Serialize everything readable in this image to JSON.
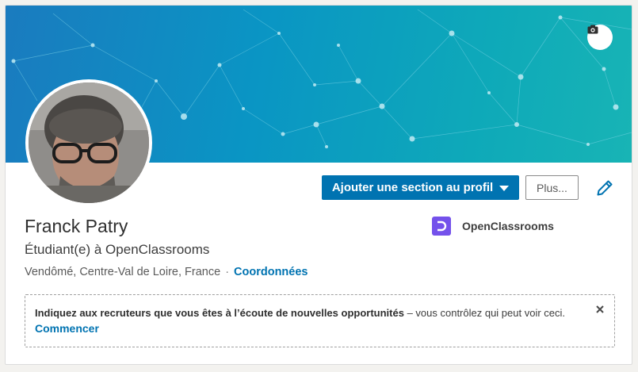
{
  "profile": {
    "name": "Franck Patry",
    "headline": "Étudiant(e) à OpenClassrooms",
    "location": "Vendômé, Centre-Val de Loire, France",
    "separator": "·",
    "contact_link": "Coordonnées"
  },
  "actions": {
    "add_section_label": "Ajouter une section au profil",
    "more_label": "Plus..."
  },
  "company": {
    "name": "OpenClassrooms",
    "logo_color": "#7451eb"
  },
  "open_to_work": {
    "message_strong": "Indiquez aux recruteurs que vous êtes à l’écoute de nouvelles opportunités",
    "message_rest": " – vous contrôlez qui peut voir ceci.",
    "link_label": "Commencer"
  },
  "icons": {
    "camera": "camera-icon",
    "edit": "pencil-icon",
    "close": "close-icon",
    "dropdown": "caret-down-icon"
  },
  "colors": {
    "primary": "#0073b1",
    "cover_start": "#1a7bbf",
    "cover_end": "#18b4b5"
  }
}
